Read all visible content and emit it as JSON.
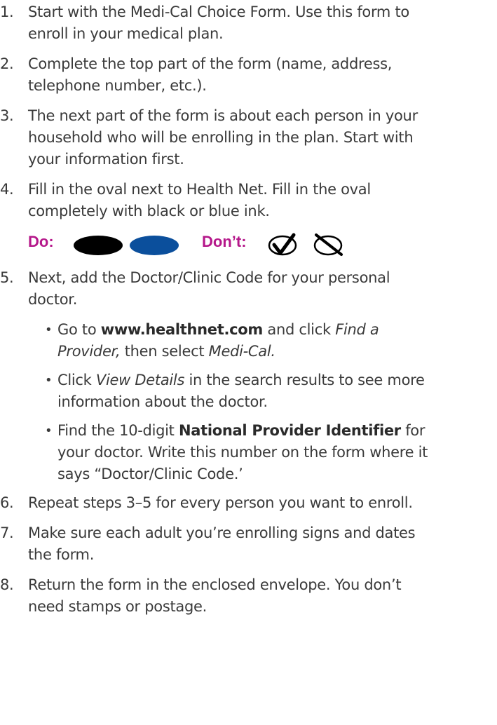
{
  "steps": [
    {
      "num": "1.",
      "lines": [
        "Start with the Medi-Cal Choice Form. Use this form to",
        "enroll in your medical plan."
      ]
    },
    {
      "num": "2.",
      "lines": [
        "Complete the top part of the form (name, address,",
        "telephone number, etc.)."
      ]
    },
    {
      "num": "3.",
      "lines": [
        "The next part of the form is about each person in your",
        "household who will be enrolling in the plan. Start with",
        "your information first."
      ]
    },
    {
      "num": "4.",
      "lines": [
        "Fill in the oval next to Health Net. Fill in the oval",
        "completely with black or blue ink."
      ]
    },
    {
      "num": "5.",
      "lines": [
        "Next, add the Doctor/Clinic Code for your personal",
        "doctor."
      ]
    },
    {
      "num": "6.",
      "lines": [
        "Repeat steps 3–5 for every person you want to enroll."
      ]
    },
    {
      "num": "7.",
      "lines": [
        "Make sure each adult you’re enrolling signs and dates",
        "the form."
      ]
    },
    {
      "num": "8.",
      "lines": [
        "Return the form in the enclosed envelope. You don’t",
        "need stamps or postage."
      ]
    }
  ],
  "do_dont": {
    "do_label": "Do:",
    "dont_label": "Don’t:",
    "colors": {
      "label": "#b5178a",
      "black_oval": "#000000",
      "blue_oval": "#0b4f9c"
    }
  },
  "sub_bullets": {
    "b1": {
      "t1": "Go to ",
      "bold": "www.healthnet.com",
      "t2": " and click ",
      "it1": "Find a",
      "it2": "Provider,",
      "t3": " then select ",
      "it3": "Medi-Cal."
    },
    "b2": {
      "t1": "Click ",
      "it1": "View Details",
      "t2": " in the search results to see more",
      "line2": "information about the doctor."
    },
    "b3": {
      "t1": "Find the 10-digit ",
      "bold": "National Provider Identifier",
      "t2": " for",
      "line2": "your doctor. Write this number on the form where it",
      "line3": "says “Doctor/Clinic Code.’"
    },
    "bullet_char": "•"
  }
}
